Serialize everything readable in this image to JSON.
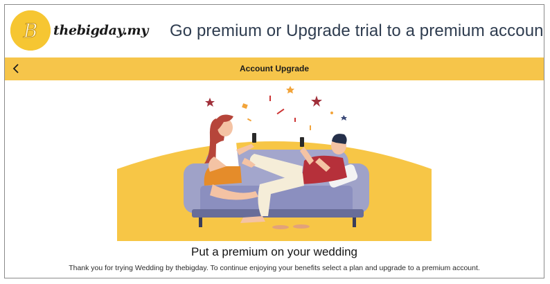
{
  "brand": {
    "logo_letter": "B",
    "name": "thebigday.my",
    "logo_icon": "b-logo-icon",
    "accent": "#f6c54a"
  },
  "headline": "Go premium or Upgrade trial to a premium account",
  "toolbar": {
    "back_icon": "chevron-left-icon",
    "title": "Account Upgrade"
  },
  "hero": {
    "illustration_icon": "couple-on-sofa-illustration",
    "title": "Put a premium on your wedding",
    "description": "Thank you for trying Wedding by thebigday. To continue enjoying your benefits select a plan and upgrade to a premium account."
  }
}
